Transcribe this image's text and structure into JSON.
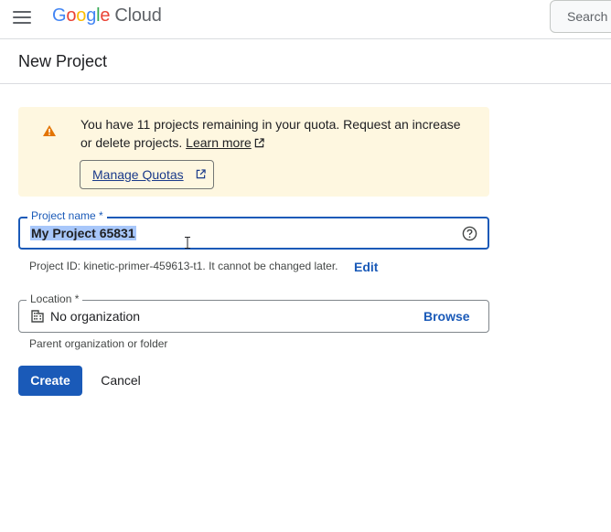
{
  "header": {
    "logo": {
      "g1": "G",
      "g2": "o",
      "g3": "o",
      "g4": "g",
      "g5": "l",
      "g6": "e",
      "product": "Cloud"
    },
    "search_label": "Search (",
    "menu_icon": "hamburger-menu-icon"
  },
  "page": {
    "title": "New Project"
  },
  "alert": {
    "icon": "warning-icon",
    "text": "You have 11 projects remaining in your quota. Request an increase or delete projects. ",
    "learn_more": "Learn more",
    "manage_quotas": "Manage Quotas"
  },
  "form": {
    "project_name": {
      "label": "Project name *",
      "value": "My Project 65831",
      "help_icon": "help-circle-icon"
    },
    "project_id": {
      "text": "Project ID: kinetic-primer-459613-t1. It cannot be changed later.",
      "edit_label": "Edit"
    },
    "location": {
      "label": "Location *",
      "value": "No organization",
      "icon": "building-icon",
      "browse_label": "Browse",
      "helper": "Parent organization or folder"
    }
  },
  "actions": {
    "create_label": "Create",
    "cancel_label": "Cancel"
  },
  "colors": {
    "accent": "#1a5ab8",
    "warning_bg": "#fef7e0",
    "warning_icon": "#e37400",
    "selection": "#a8c7fa"
  }
}
